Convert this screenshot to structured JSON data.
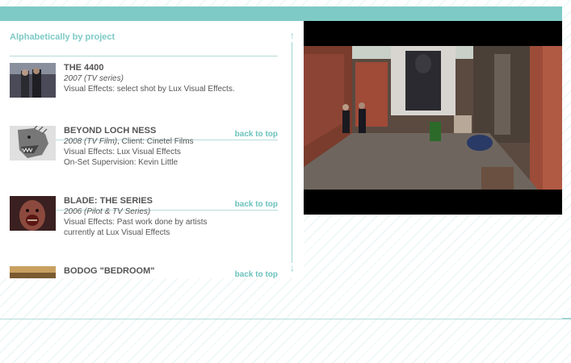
{
  "list": {
    "heading": "Alphabetically by project",
    "back_to_top": "back to top",
    "entries": [
      {
        "title": "THE 4400",
        "year": "2007 (TV series)",
        "lines": [
          "Visual Effects: select shot by Lux Visual Effects."
        ]
      },
      {
        "title": "BEYOND LOCH NESS",
        "year": "2008 (TV Film)",
        "year_suffix": ", Client: Cinetel Films",
        "lines": [
          "Visual Effects: Lux Visual Effects",
          "On-Set Supervision: Kevin Little"
        ]
      },
      {
        "title": "BLADE: THE SERIES",
        "year": "2006 (Pilot & TV Series)",
        "lines": [
          "Visual Effects: Past work done by artists",
          "currently at Lux Visual Effects"
        ]
      },
      {
        "title": "BODOG \"BEDROOM\""
      }
    ]
  },
  "colors": {
    "accent": "#7ecac6",
    "text": "#555555",
    "video_background": "#000000"
  },
  "icons": [
    "scroll-up-arrow-icon",
    "scroll-down-arrow-icon"
  ]
}
